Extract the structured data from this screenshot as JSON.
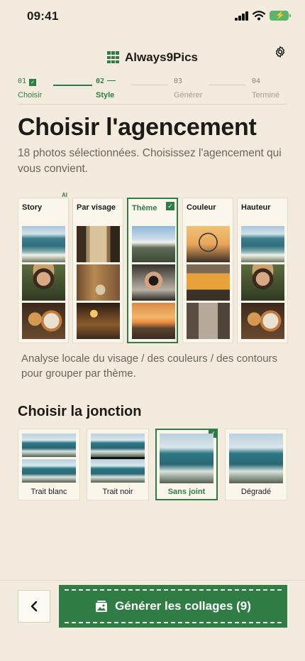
{
  "status": {
    "time": "09:41"
  },
  "header": {
    "app_title": "Always9Pics",
    "logo_icon": "grid-icon",
    "settings_icon": "gear-icon"
  },
  "stepper": {
    "steps": [
      {
        "num": "01",
        "label": "Choisir",
        "state": "done"
      },
      {
        "num": "02",
        "label": "Style",
        "state": "active"
      },
      {
        "num": "03",
        "label": "Générer",
        "state": "todo"
      },
      {
        "num": "04",
        "label": "Terminé",
        "state": "todo"
      }
    ]
  },
  "main": {
    "title": "Choisir l'agencement",
    "subtitle": "18 photos sélectionnées. Choisissez l'agencement qui vous convient.",
    "ai_badge": "AI",
    "layouts": [
      {
        "label": "Story",
        "selected": false
      },
      {
        "label": "Par visage",
        "selected": false
      },
      {
        "label": "Thème",
        "selected": true
      },
      {
        "label": "Couleur",
        "selected": false
      },
      {
        "label": "Hauteur",
        "selected": false
      }
    ],
    "layout_description": "Analyse locale du visage / des couleurs / des contours pour grouper par thème.",
    "join_title": "Choisir la jonction",
    "joins": [
      {
        "label": "Trait blanc",
        "selected": false
      },
      {
        "label": "Trait noir",
        "selected": false
      },
      {
        "label": "Sans joint",
        "selected": true
      },
      {
        "label": "Dégradé",
        "selected": false
      }
    ]
  },
  "footer": {
    "back_icon": "chevron-left-icon",
    "generate_label": "Générer les collages (9)",
    "generate_icon": "gallery-icon"
  },
  "colors": {
    "accent": "#2f7d45",
    "background": "#f3ecde"
  }
}
